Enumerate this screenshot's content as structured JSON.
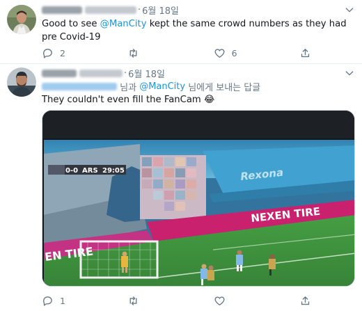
{
  "tweets": [
    {
      "date": "6월 18일",
      "text_before": "Good to see ",
      "mention": "@ManCity",
      "text_after": " kept the same crowd numbers as they had pre Covid-19",
      "actions": {
        "reply_count": "2",
        "retweet_count": "",
        "like_count": "6"
      }
    },
    {
      "date": "6월 18일",
      "reply_to": {
        "connector": " 님과 ",
        "mention": "@ManCity",
        "suffix": " 님에게 보내는 답글"
      },
      "text": "They couldn't even fill the FanCam 😂",
      "media": {
        "scoreboard": {
          "score": "0-0",
          "team": "ARS",
          "clock": "29:05"
        },
        "ad_boards": [
          "NEXEN TIRE",
          "Rexona",
          "EN TIRE"
        ]
      },
      "actions": {
        "reply_count": "1",
        "retweet_count": "",
        "like_count": ""
      }
    }
  ],
  "icons": [
    "avatar",
    "more-icon",
    "reply-icon",
    "retweet-icon",
    "like-icon",
    "share-icon"
  ],
  "colors": {
    "accent": "#1b95e0",
    "secondary_text": "#657786",
    "border": "#e6ecf0"
  }
}
